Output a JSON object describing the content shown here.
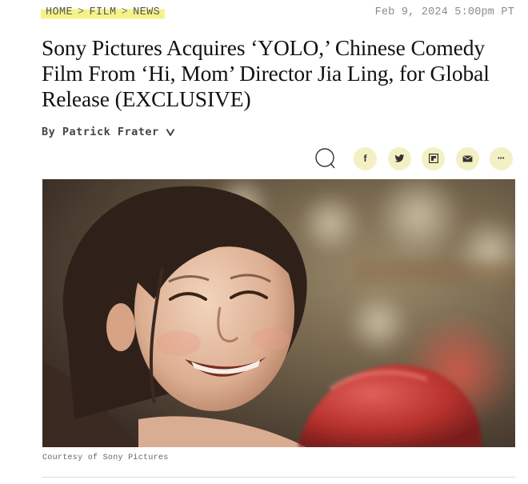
{
  "breadcrumb": {
    "items": [
      "HOME",
      "FILM",
      "NEWS"
    ],
    "separator": ">"
  },
  "timestamp": "Feb 9, 2024 5:00pm PT",
  "headline": "Sony Pictures Acquires ‘YOLO,’ Chinese Comedy Film From ‘Hi, Mom’ Director Jia Ling, for Global Release (EXCLUSIVE)",
  "byline": {
    "text": "By Patrick Frater",
    "icon": "chevron-down-icon"
  },
  "share": {
    "comment_icon": "comment-bubble-icon",
    "buttons": [
      {
        "name": "facebook",
        "glyph": "f",
        "icon": "facebook-icon"
      },
      {
        "name": "twitter",
        "icon": "twitter-icon"
      },
      {
        "name": "flipboard",
        "icon": "flipboard-icon"
      },
      {
        "name": "email",
        "icon": "email-icon"
      },
      {
        "name": "more",
        "glyph": "•••",
        "icon": "more-dots-icon"
      }
    ],
    "button_color": "#f3f1c4"
  },
  "hero": {
    "subject": "Smiling woman wearing a red boxing glove"
  },
  "caption": "Courtesy of Sony Pictures",
  "colors": {
    "highlight": "#f6f28a",
    "headline": "#111111",
    "muted": "#8a8a8a",
    "glove_red": "#c33a35"
  }
}
